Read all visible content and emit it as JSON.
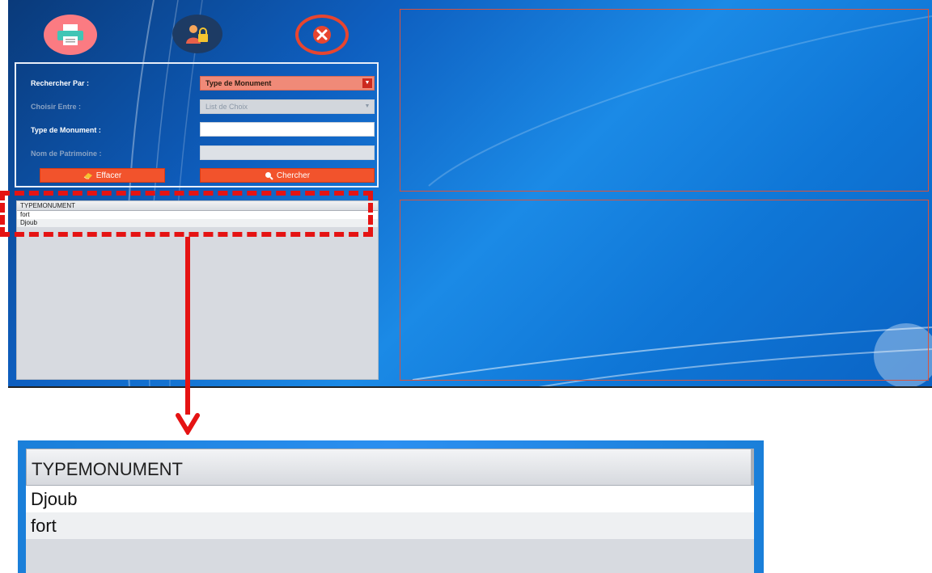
{
  "toolbar": {
    "print_icon": "printer-icon",
    "user_lock_icon": "user-lock-icon",
    "close_icon": "close-icon"
  },
  "form": {
    "search_by_label": "Rechercher Par :",
    "search_by_value": "Type de Monument",
    "choose_between_label": "Choisir Entre :",
    "choose_between_value": "List de Choix",
    "monument_type_label": "Type de Monument :",
    "monument_type_value": "",
    "heritage_name_label": "Nom de Patrimoine :",
    "heritage_name_value": "",
    "clear_label": "Effacer",
    "search_label": "Chercher"
  },
  "results": {
    "column": "TYPEMONUMENT",
    "rows": [
      "fort",
      "Djoub"
    ]
  },
  "zoom": {
    "column": "TYPEMONUMENT",
    "rows": [
      "Djoub",
      "fort"
    ]
  },
  "colors": {
    "accent": "#f2532c",
    "highlight": "#e51313",
    "frame_border": "#d9523d"
  }
}
